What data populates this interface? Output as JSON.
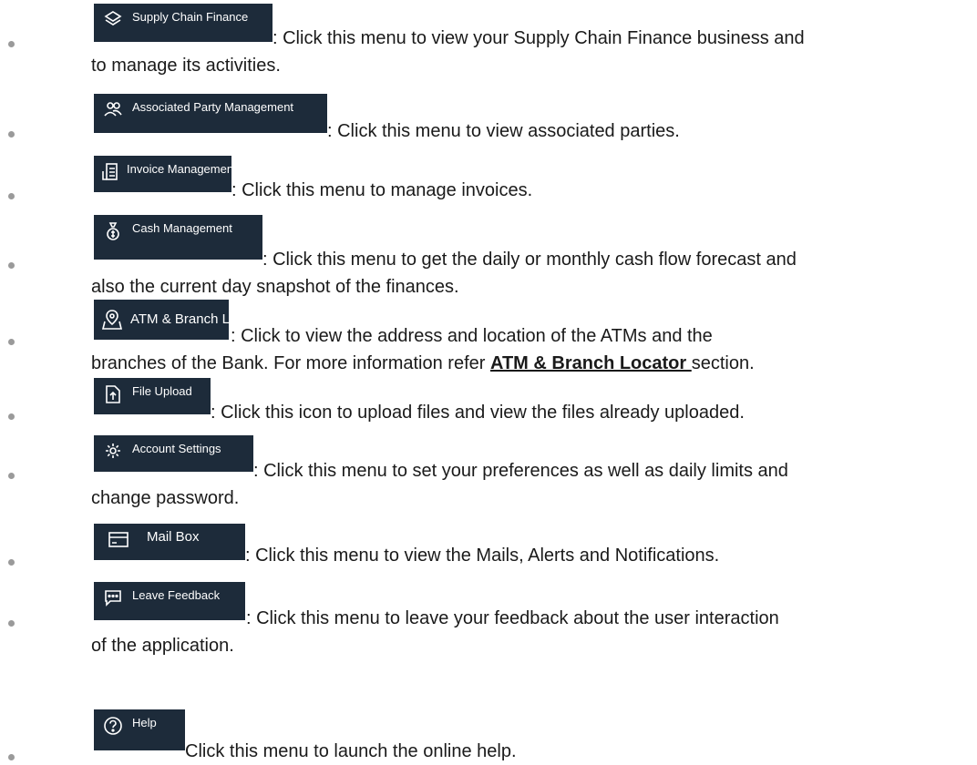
{
  "items": [
    {
      "button": "Supply Chain Finance",
      "icon": "layers-icon",
      "line1": ": Click this menu to view your Supply Chain Finance business and",
      "line2": "to manage its activities."
    },
    {
      "button": "Associated Party Management",
      "icon": "users-icon",
      "line1": ": Click this menu to view associated parties."
    },
    {
      "button": "Invoice Management",
      "icon": "invoice-icon",
      "line1": ": Click this menu to manage invoices."
    },
    {
      "button": "Cash Management",
      "icon": "money-bag-icon",
      "line1": ": Click this menu to get the daily or monthly cash flow forecast and",
      "line2": "also the current day snapshot of the finances."
    },
    {
      "button": "ATM & Branch Locator",
      "icon": "map-pin-icon",
      "line1": ": Click to view the address and location of the ATMs and the",
      "line2_pre": "branches of the Bank. For more information refer ",
      "line2_link": "ATM & Branch Locator ",
      "line2_post": "section."
    },
    {
      "button": "File Upload",
      "icon": "file-upload-icon",
      "line1": ": Click this icon to upload files and view the files already uploaded."
    },
    {
      "button": "Account Settings",
      "icon": "gear-icon",
      "line1": ": Click this menu to set your preferences as well as daily limits and",
      "line2": "change password."
    },
    {
      "button": "Mail Box",
      "icon": "mailbox-icon",
      "line1": ": Click this menu to view the Mails, Alerts and Notifications."
    },
    {
      "button": "Leave Feedback",
      "icon": "chat-bubble-icon",
      "line1": ": Click this menu to leave your feedback about the user interaction",
      "line2": "of the application."
    },
    {
      "button": "Help",
      "icon": "help-icon",
      "line1": "Click this menu to launch the online help."
    }
  ]
}
